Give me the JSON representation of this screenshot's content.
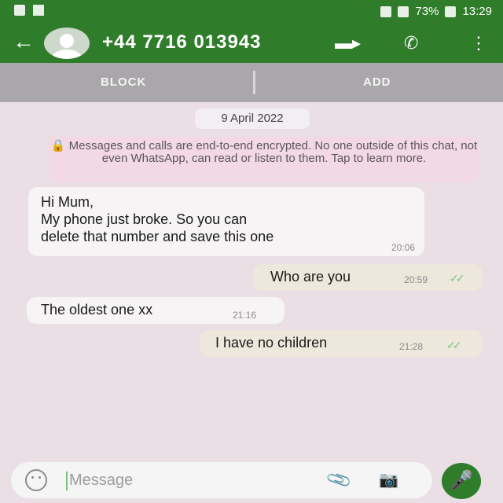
{
  "status_bar": {
    "battery": "73%",
    "time": "13:29"
  },
  "header": {
    "back_icon": "arrow-left-icon",
    "avatar_icon": "default-avatar-icon",
    "title": "+44 7716 013943",
    "video_icon": "video-call-icon",
    "call_icon": "phone-icon",
    "menu_icon": "more-vert-icon"
  },
  "actions": {
    "block": "BLOCK",
    "add": "ADD"
  },
  "date": "9 April 2022",
  "encryption_notice": "🔒 Messages and calls are end-to-end encrypted. No one outside of this chat, not even WhatsApp, can read or listen to them. Tap to learn more.",
  "messages": [
    {
      "direction": "incoming",
      "text_lines": [
        "Hi Mum,",
        "My phone just broke. So you can",
        "delete that number and save this one"
      ],
      "time": "20:06"
    },
    {
      "direction": "outgoing",
      "text": "Who are you",
      "time": "20:59",
      "status_icon": "double-tick-icon"
    },
    {
      "direction": "incoming",
      "text": "The oldest one xx",
      "time": "21:16"
    },
    {
      "direction": "outgoing",
      "text": "I have no children",
      "time": "21:28",
      "status_icon": "double-tick-icon"
    }
  ],
  "composer": {
    "placeholder": "Message",
    "emoji_icon": "emoji-icon",
    "attach_icon": "paperclip-icon",
    "camera_icon": "camera-icon"
  },
  "mic_icon": "mic-icon",
  "colors": {
    "brand_green": "#2f7d2a",
    "chat_bg": "#e9dfe4",
    "incoming_bubble": "#f7f4f6",
    "outgoing_bubble": "#eee7dc"
  }
}
